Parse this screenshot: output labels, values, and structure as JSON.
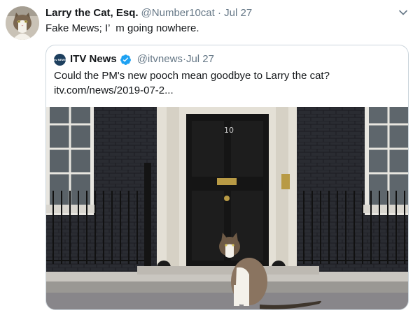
{
  "tweet": {
    "author_name": "Larry the Cat, Esq.",
    "author_handle": "@Number10cat",
    "separator": " · ",
    "time": "Jul 27",
    "text": "Fake Mews; I’  m going nowhere."
  },
  "quoted": {
    "logo_text": "itv NEWS",
    "author_name": "ITV News",
    "author_handle": "@itvnews",
    "separator": " · ",
    "time": "Jul 27",
    "text": "Could the PM's new pooch mean goodbye to Larry the cat?",
    "link": "itv.com/news/2019-07-2...",
    "door_number": "10"
  },
  "colors": {
    "text_primary": "#14171a",
    "text_secondary": "#657786",
    "border": "#ccd6dd",
    "verified": "#1da1f2",
    "brick": "#2b2d33",
    "door": "#151515"
  },
  "icons": {
    "caret": "chevron-down-icon",
    "verified": "verified-badge-icon"
  }
}
